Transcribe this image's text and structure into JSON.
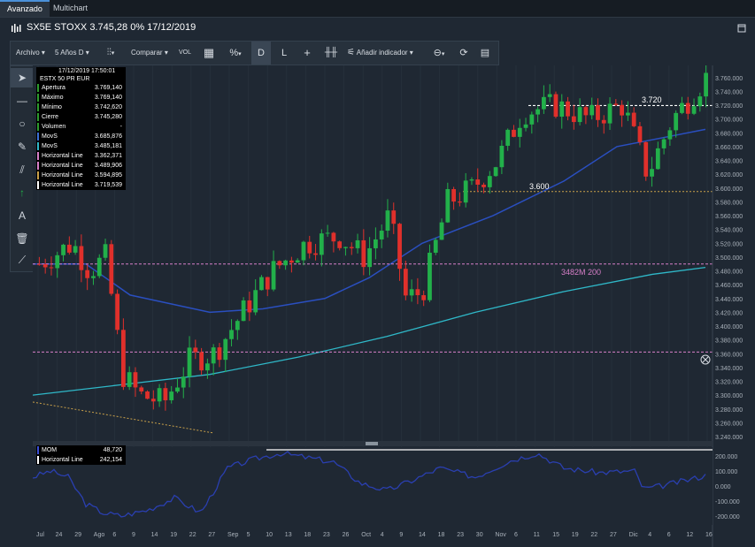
{
  "tabs": [
    {
      "label": "Avanzado",
      "active": true
    },
    {
      "label": "Multichart",
      "active": false
    }
  ],
  "title": "SX5E STOXX 3.745,28 0% 17/12/2019",
  "toolbar": {
    "archivo": "Archivo",
    "periodo": "5 Años D",
    "comparar": "Comparar",
    "vol": "VOL",
    "percent": "%",
    "mode_d": "D",
    "mode_l": "L",
    "add_indicator": "Añadir indicador"
  },
  "left_tools": [
    "cursor-icon",
    "line-icon",
    "circle-icon",
    "pen-icon",
    "parallel-icon",
    "arrow-up-icon",
    "text-icon",
    "trash-icon",
    "ruler-icon"
  ],
  "info_panel": {
    "datetime": "17/12/2019 17:50:01",
    "symbol": "ESTX 50 PR EUR",
    "rows": [
      {
        "k": "Apertura",
        "v": "3.769,140",
        "c": "#2e9a2e"
      },
      {
        "k": "Máximo",
        "v": "3.769,140",
        "c": "#2e9a2e"
      },
      {
        "k": "Mínimo",
        "v": "3.742,620",
        "c": "#2e9a2e"
      },
      {
        "k": "Cierre",
        "v": "3.745,280",
        "c": "#2e9a2e"
      },
      {
        "k": "Volumen",
        "v": "-",
        "c": "#2e9a2e"
      },
      {
        "k": "MovS",
        "v": "3.685,876",
        "c": "#3b6fd6"
      },
      {
        "k": "MovS",
        "v": "3.485,181",
        "c": "#2fb8c8"
      },
      {
        "k": "Horizontal Line",
        "v": "3.362,371",
        "c": "#d77fc9"
      },
      {
        "k": "Horizontal Line",
        "v": "3.489,906",
        "c": "#d77fc9"
      },
      {
        "k": "Horizontal Line",
        "v": "3.594,895",
        "c": "#c9a14a"
      },
      {
        "k": "Horizontal Line",
        "v": "3.719,539",
        "c": "#ffffff"
      }
    ]
  },
  "mom_panel": {
    "rows": [
      {
        "k": "MOM",
        "v": "48,720",
        "c": "#3b4fd6"
      },
      {
        "k": "Horizontal Line",
        "v": "242,154",
        "c": "#ffffff"
      }
    ]
  },
  "annotations": {
    "l3720": "3.720",
    "l3600": "3.600",
    "l3482": "3482M 200"
  },
  "colors": {
    "up": "#22b04a",
    "down": "#e0302b",
    "ma1": "#2a4fc0",
    "ma2": "#2fb8c8",
    "pink": "#d77fc9",
    "gold": "#c9a14a"
  },
  "y_ticks": [
    "3.760.000",
    "3.740.000",
    "3.720.000",
    "3.700.000",
    "3.680.000",
    "3.660.000",
    "3.640.000",
    "3.620.000",
    "3.600.000",
    "3.580.000",
    "3.560.000",
    "3.540.000",
    "3.520.000",
    "3.500.000",
    "3.480.000",
    "3.460.000",
    "3.440.000",
    "3.420.000",
    "3.400.000",
    "3.380.000",
    "3.360.000",
    "3.340.000",
    "3.320.000",
    "3.300.000",
    "3.280.000",
    "3.260.000",
    "3.240.000"
  ],
  "mom_ticks": [
    "200.000",
    "100.000",
    "0.000",
    "-100.000",
    "-200.000"
  ],
  "x_ticks": [
    "Jul",
    "24",
    "29",
    "Ago",
    "6",
    "9",
    "14",
    "19",
    "22",
    "27",
    "Sep",
    "5",
    "10",
    "13",
    "18",
    "23",
    "26",
    "Oct",
    "4",
    "9",
    "14",
    "18",
    "23",
    "30",
    "Nov",
    "6",
    "11",
    "15",
    "19",
    "22",
    "27",
    "Dic",
    "4",
    "6",
    "12",
    "16"
  ]
}
